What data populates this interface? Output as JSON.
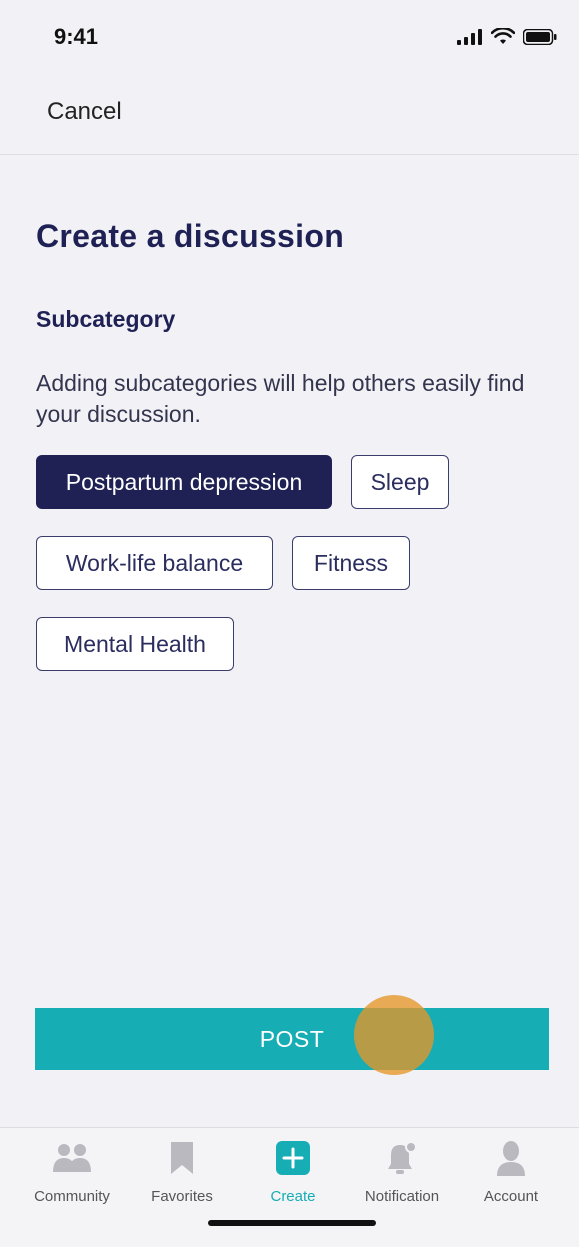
{
  "status_bar": {
    "time": "9:41"
  },
  "nav": {
    "cancel_label": "Cancel"
  },
  "page": {
    "title": "Create a discussion",
    "section_title": "Subcategory",
    "help_text": "Adding subcategories will help others easily find your discussion."
  },
  "chips": [
    {
      "label": "Postpartum depression",
      "selected": true
    },
    {
      "label": "Sleep",
      "selected": false
    },
    {
      "label": "Work-life balance",
      "selected": false
    },
    {
      "label": "Fitness",
      "selected": false
    },
    {
      "label": "Mental Health",
      "selected": false
    }
  ],
  "post_button": {
    "label": "POST"
  },
  "tab_bar": {
    "items": [
      {
        "label": "Community",
        "icon": "community-icon",
        "active": false
      },
      {
        "label": "Favorites",
        "icon": "bookmark-icon",
        "active": false
      },
      {
        "label": "Create",
        "icon": "plus-icon",
        "active": true
      },
      {
        "label": "Notification",
        "icon": "bell-icon",
        "active": false
      },
      {
        "label": "Account",
        "icon": "person-icon",
        "active": false
      }
    ]
  },
  "colors": {
    "primary_navy": "#1f2155",
    "accent_teal": "#17adb5",
    "background": "#f2f2f6",
    "inactive_icon": "#b9b9bf"
  }
}
